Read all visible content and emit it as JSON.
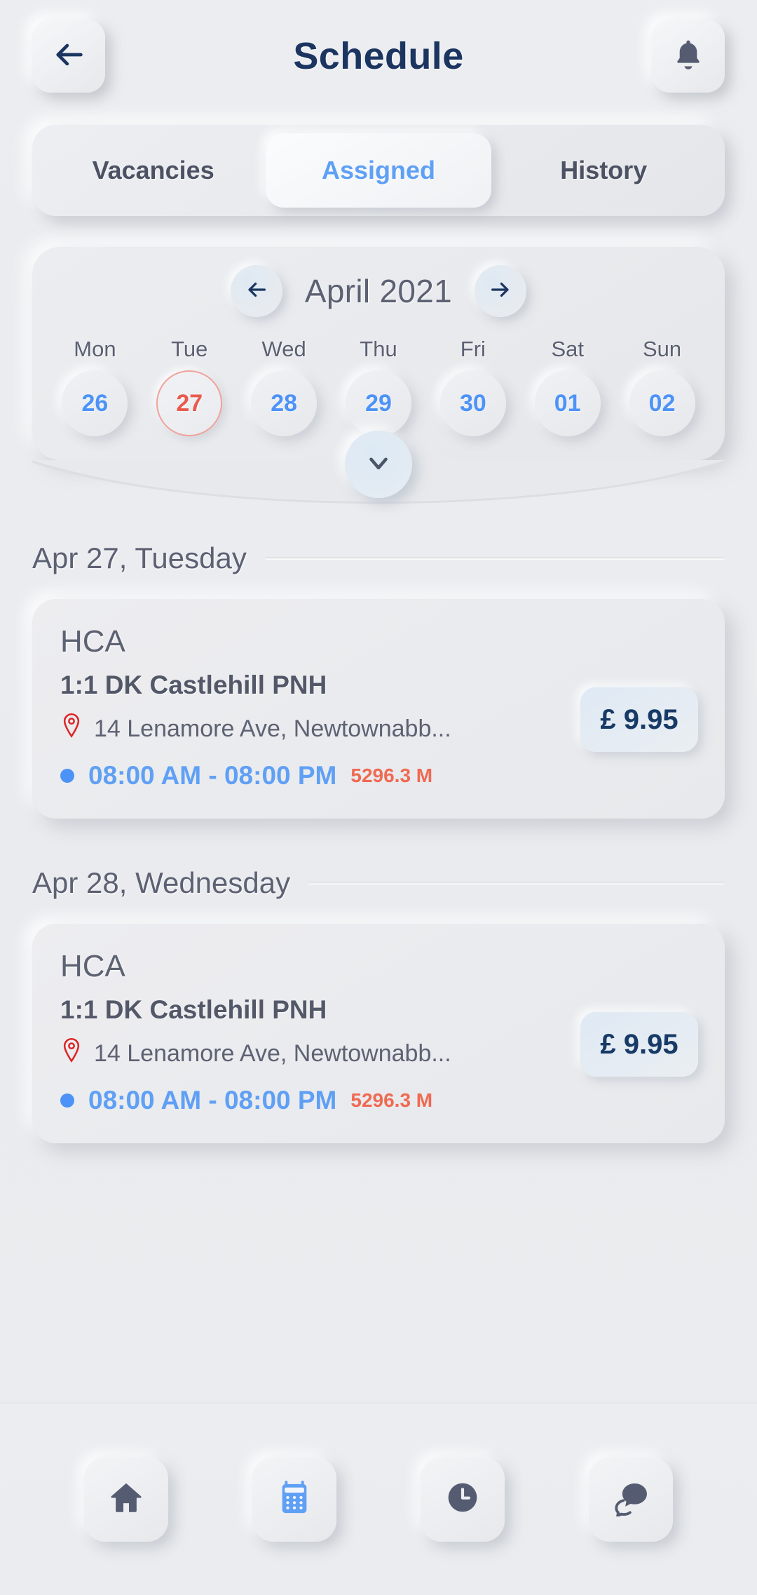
{
  "header": {
    "title": "Schedule",
    "back_icon": "arrow-left-icon",
    "bell_icon": "bell-icon"
  },
  "tabs": [
    {
      "label": "Vacancies",
      "active": false
    },
    {
      "label": "Assigned",
      "active": true
    },
    {
      "label": "History",
      "active": false
    }
  ],
  "calendar": {
    "month_label": "April 2021",
    "prev_icon": "arrow-left-icon",
    "next_icon": "arrow-right-icon",
    "expand_icon": "chevron-down-icon",
    "weekdays": [
      "Mon",
      "Tue",
      "Wed",
      "Thu",
      "Fri",
      "Sat",
      "Sun"
    ],
    "dates": [
      {
        "day": "26",
        "selected": false
      },
      {
        "day": "27",
        "selected": true
      },
      {
        "day": "28",
        "selected": false
      },
      {
        "day": "29",
        "selected": false
      },
      {
        "day": "30",
        "selected": false
      },
      {
        "day": "01",
        "selected": false
      },
      {
        "day": "02",
        "selected": false
      }
    ]
  },
  "groups": [
    {
      "day_label": "Apr 27, Tuesday",
      "job": {
        "role": "HCA",
        "title": "1:1 DK Castlehill PNH",
        "address": "14 Lenamore Ave, Newtownabb...",
        "address_icon": "location-pin-icon",
        "time": "08:00 AM - 08:00 PM",
        "distance": "5296.3 M",
        "price": "£ 9.95"
      }
    },
    {
      "day_label": "Apr 28, Wednesday",
      "job": {
        "role": "HCA",
        "title": "1:1 DK Castlehill PNH",
        "address": "14 Lenamore Ave, Newtownabb...",
        "address_icon": "location-pin-icon",
        "time": "08:00 AM - 08:00 PM",
        "distance": "5296.3 M",
        "price": "£ 9.95"
      }
    }
  ],
  "bottom_nav": [
    {
      "icon": "home-icon",
      "active": false
    },
    {
      "icon": "calendar-icon",
      "active": true
    },
    {
      "icon": "clock-icon",
      "active": false
    },
    {
      "icon": "chat-icon",
      "active": false
    }
  ],
  "colors": {
    "background": "#eaecef",
    "title": "#1b3560",
    "accent_blue": "#5fa0f5",
    "date_blue": "#4d93f7",
    "selected_red": "#e85a4f",
    "distance_orange": "#ef6a52",
    "pin_red": "#dc2626",
    "text_gray": "#5c6173",
    "price_navy": "#173a66"
  }
}
